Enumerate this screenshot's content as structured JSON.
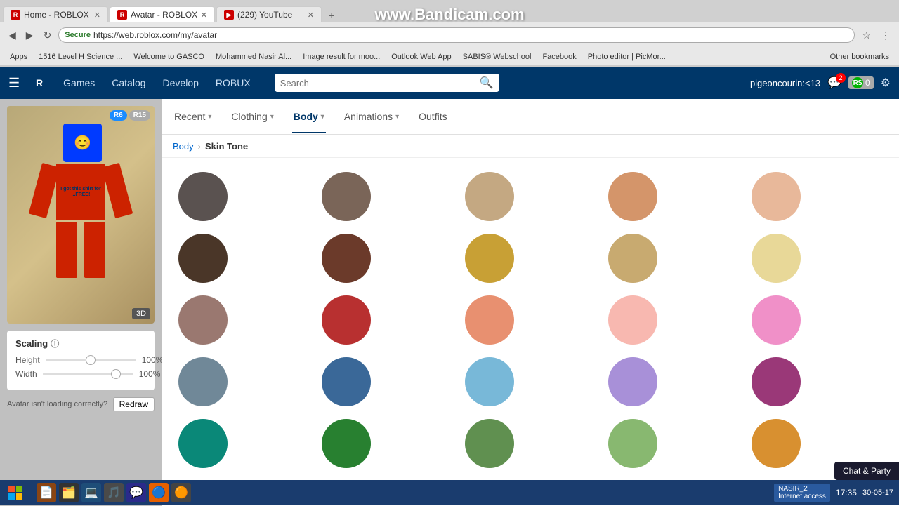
{
  "watermark": "www.Bandicam.com",
  "browser": {
    "tabs": [
      {
        "label": "Home - ROBLOX",
        "active": false,
        "favicon_color": "#cc0000"
      },
      {
        "label": "Avatar - ROBLOX",
        "active": true,
        "favicon_color": "#cc0000"
      },
      {
        "label": "(229) YouTube",
        "active": false,
        "favicon_color": "#cc0000"
      }
    ],
    "address": "https://web.roblox.com/my/avatar",
    "secure_label": "Secure",
    "bookmarks": [
      "Apps",
      "1516 Level H Science ...",
      "Welcome to GASCO",
      "Mohammed Nasir Al...",
      "Image result for moo...",
      "Outlook Web App",
      "SABIS® Webschool",
      "Facebook",
      "Photo editor | PicMor...",
      "Other bookmarks"
    ]
  },
  "roblox_nav": {
    "links": [
      "Games",
      "Catalog",
      "Develop",
      "ROBUX"
    ],
    "search_placeholder": "Search",
    "username": "pigeoncourin:<13",
    "robux_count": "0"
  },
  "avatar_panel": {
    "r6_label": "R6",
    "r15_label": "R15",
    "view_3d": "3D",
    "scaling": {
      "title": "Scaling",
      "height_label": "Height",
      "height_value": "100%",
      "width_label": "Width",
      "width_value": "100%",
      "height_slider": 50,
      "width_slider": 85
    },
    "redraw_prompt": "Avatar isn't loading correctly?",
    "redraw_btn": "Redraw"
  },
  "category_tabs": [
    {
      "label": "Recent",
      "has_arrow": true,
      "active": false
    },
    {
      "label": "Clothing",
      "has_arrow": true,
      "active": false
    },
    {
      "label": "Body",
      "has_arrow": true,
      "active": true
    },
    {
      "label": "Animations",
      "has_arrow": true,
      "active": false
    },
    {
      "label": "Outfits",
      "has_arrow": false,
      "active": false
    }
  ],
  "breadcrumb": {
    "parent": "Body",
    "current": "Skin Tone"
  },
  "skin_tones": [
    "#5a5250",
    "#7a6558",
    "#c4a882",
    "#d4956a",
    "#e8b89a",
    "#4a3628",
    "#6b3a2a",
    "#c8a035",
    "#c8aa70",
    "#e8d898",
    "#9a7870",
    "#b83030",
    "#e89070",
    "#f8b8b0",
    "#f090c8",
    "#708898",
    "#3a6898",
    "#78b8d8",
    "#a890d8",
    "#9a3878",
    "#0a8878",
    "#288030",
    "#609050",
    "#88b870",
    "#d89030"
  ],
  "chat_party": {
    "label": "Chat &",
    "sublabel": "Party"
  },
  "taskbar": {
    "apps": [
      "🪟",
      "📄",
      "🗂️",
      "💻",
      "🔧",
      "📁",
      "🎵",
      "🔵",
      "🟠"
    ],
    "network": "NASIR_2\nInternet access",
    "time": "17:35",
    "date": "30-05-17"
  }
}
